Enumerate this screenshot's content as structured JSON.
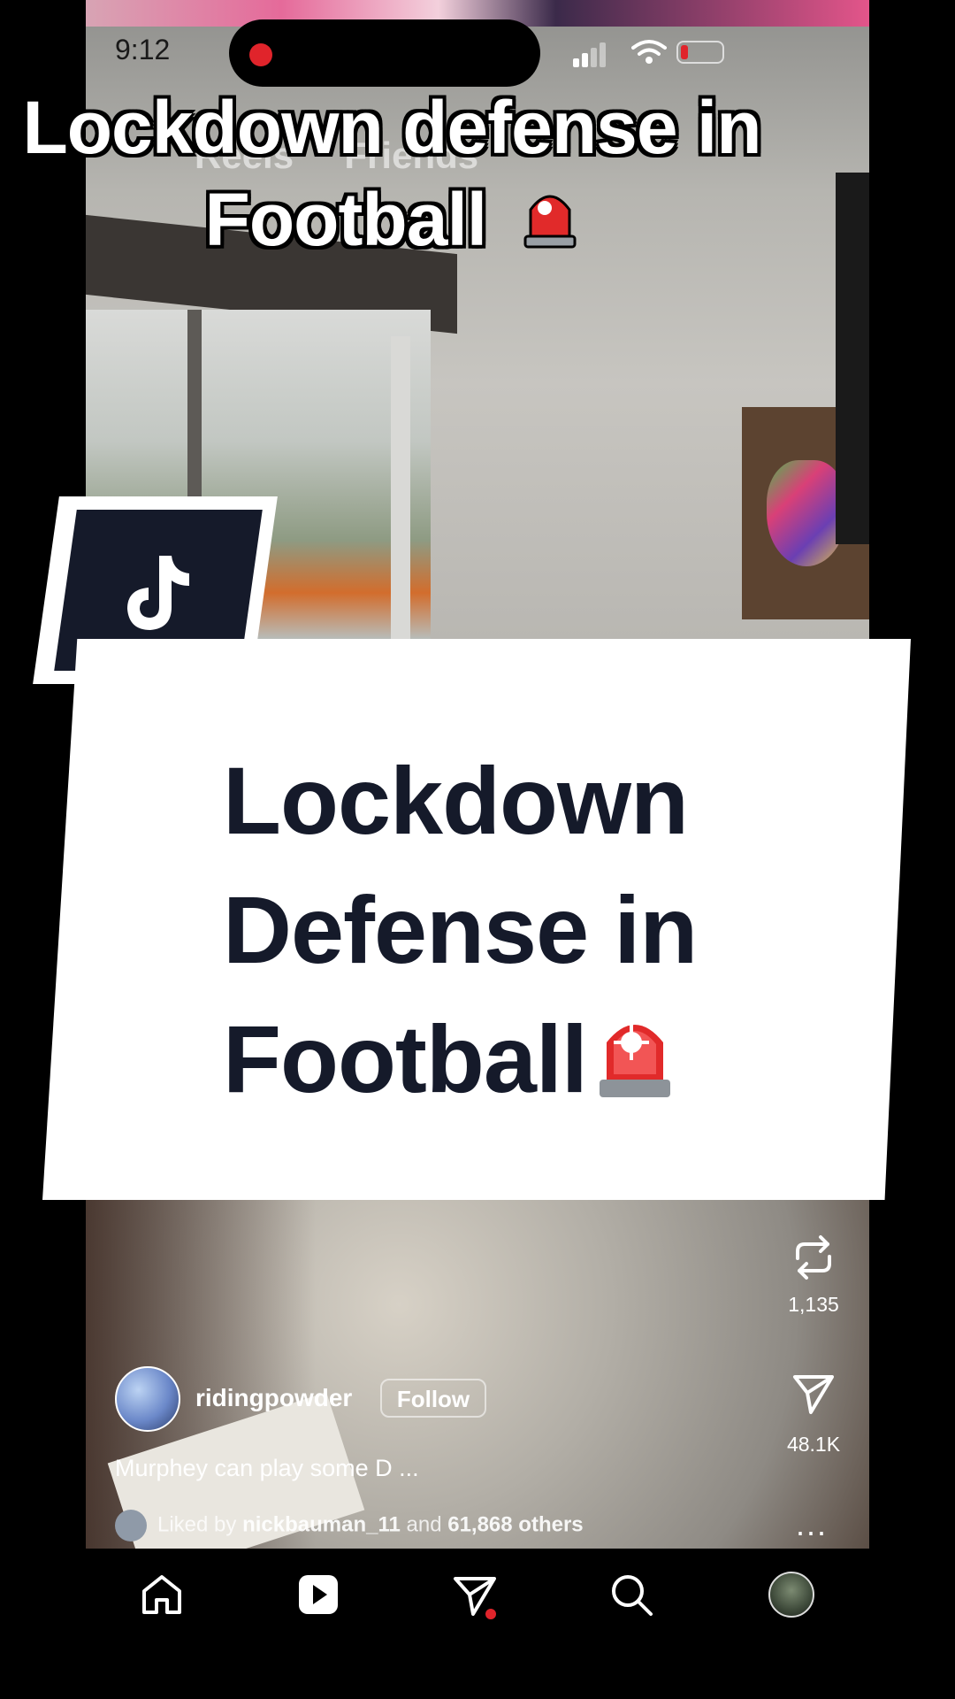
{
  "status_bar": {
    "time": "9:12"
  },
  "overlay": {
    "top_caption_line1": "Lockdown defense in",
    "top_caption_line2": "Football",
    "card_line1": "Lockdown",
    "card_line2": "Defense in",
    "card_line3": "Football"
  },
  "background_tabs": {
    "reels": "Reels",
    "friends": "Friends"
  },
  "actions": {
    "repost_count": "1,135",
    "share_count": "48.1K",
    "more": "..."
  },
  "post": {
    "username": "ridingpowder",
    "follow_label": "Follow",
    "caption": "Murphey can play some D ...",
    "liked_prefix": "Liked by",
    "liked_user": "nickbauman_11",
    "liked_joiner": "and",
    "liked_others": "61,868 others"
  },
  "nav": {
    "items": [
      "home",
      "reels",
      "direct",
      "search",
      "profile"
    ]
  },
  "colors": {
    "accent_red": "#e0242b",
    "card_text": "#151a2a"
  }
}
